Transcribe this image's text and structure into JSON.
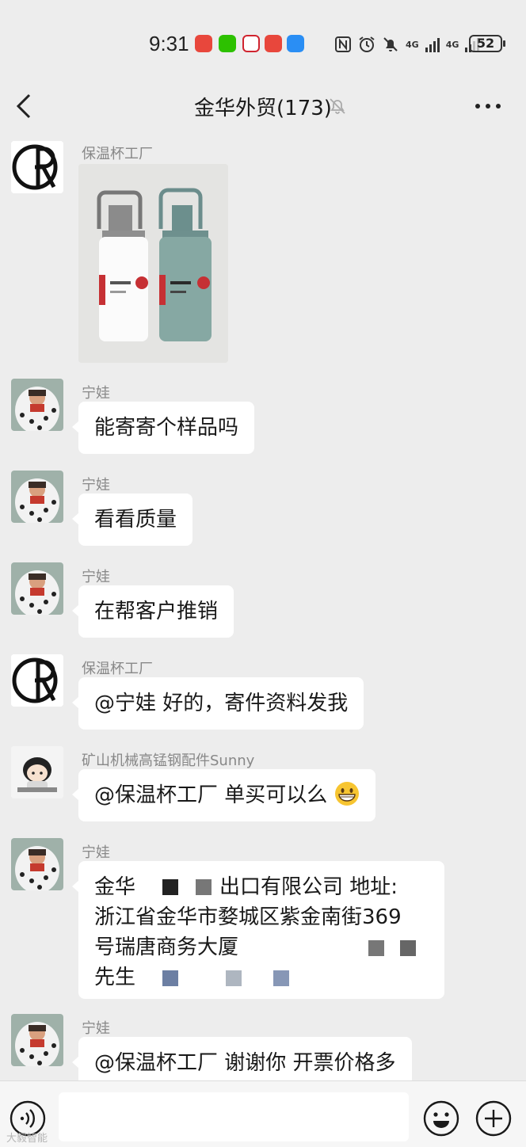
{
  "status_bar": {
    "time": "9:31",
    "network_1": "4G",
    "network_2": "4G",
    "battery": "52"
  },
  "header": {
    "title": "金华外贸(173)"
  },
  "messages": [
    {
      "sender": "保温杯工厂",
      "type": "image"
    },
    {
      "sender": "宁娃",
      "text": "能寄寄个样品吗"
    },
    {
      "sender": "宁娃",
      "text": "看看质量"
    },
    {
      "sender": "宁娃",
      "text": "在帮客户推销"
    },
    {
      "sender": "保温杯工厂",
      "text": "@宁娃  好的，寄件资料发我"
    },
    {
      "sender": "矿山机械高锰钢配件Sunny",
      "text": "@保温杯工厂  单买可以么"
    },
    {
      "sender": "宁娃",
      "lines": [
        "金华",
        "出口有限公司 地址:",
        "浙江省金华市婺城区紫金南街369",
        "号瑞唐商务大厦",
        "先生"
      ]
    },
    {
      "sender": "宁娃",
      "text": "@保温杯工厂  谢谢你 开票价格多"
    }
  ],
  "watermark": "大毅智能"
}
